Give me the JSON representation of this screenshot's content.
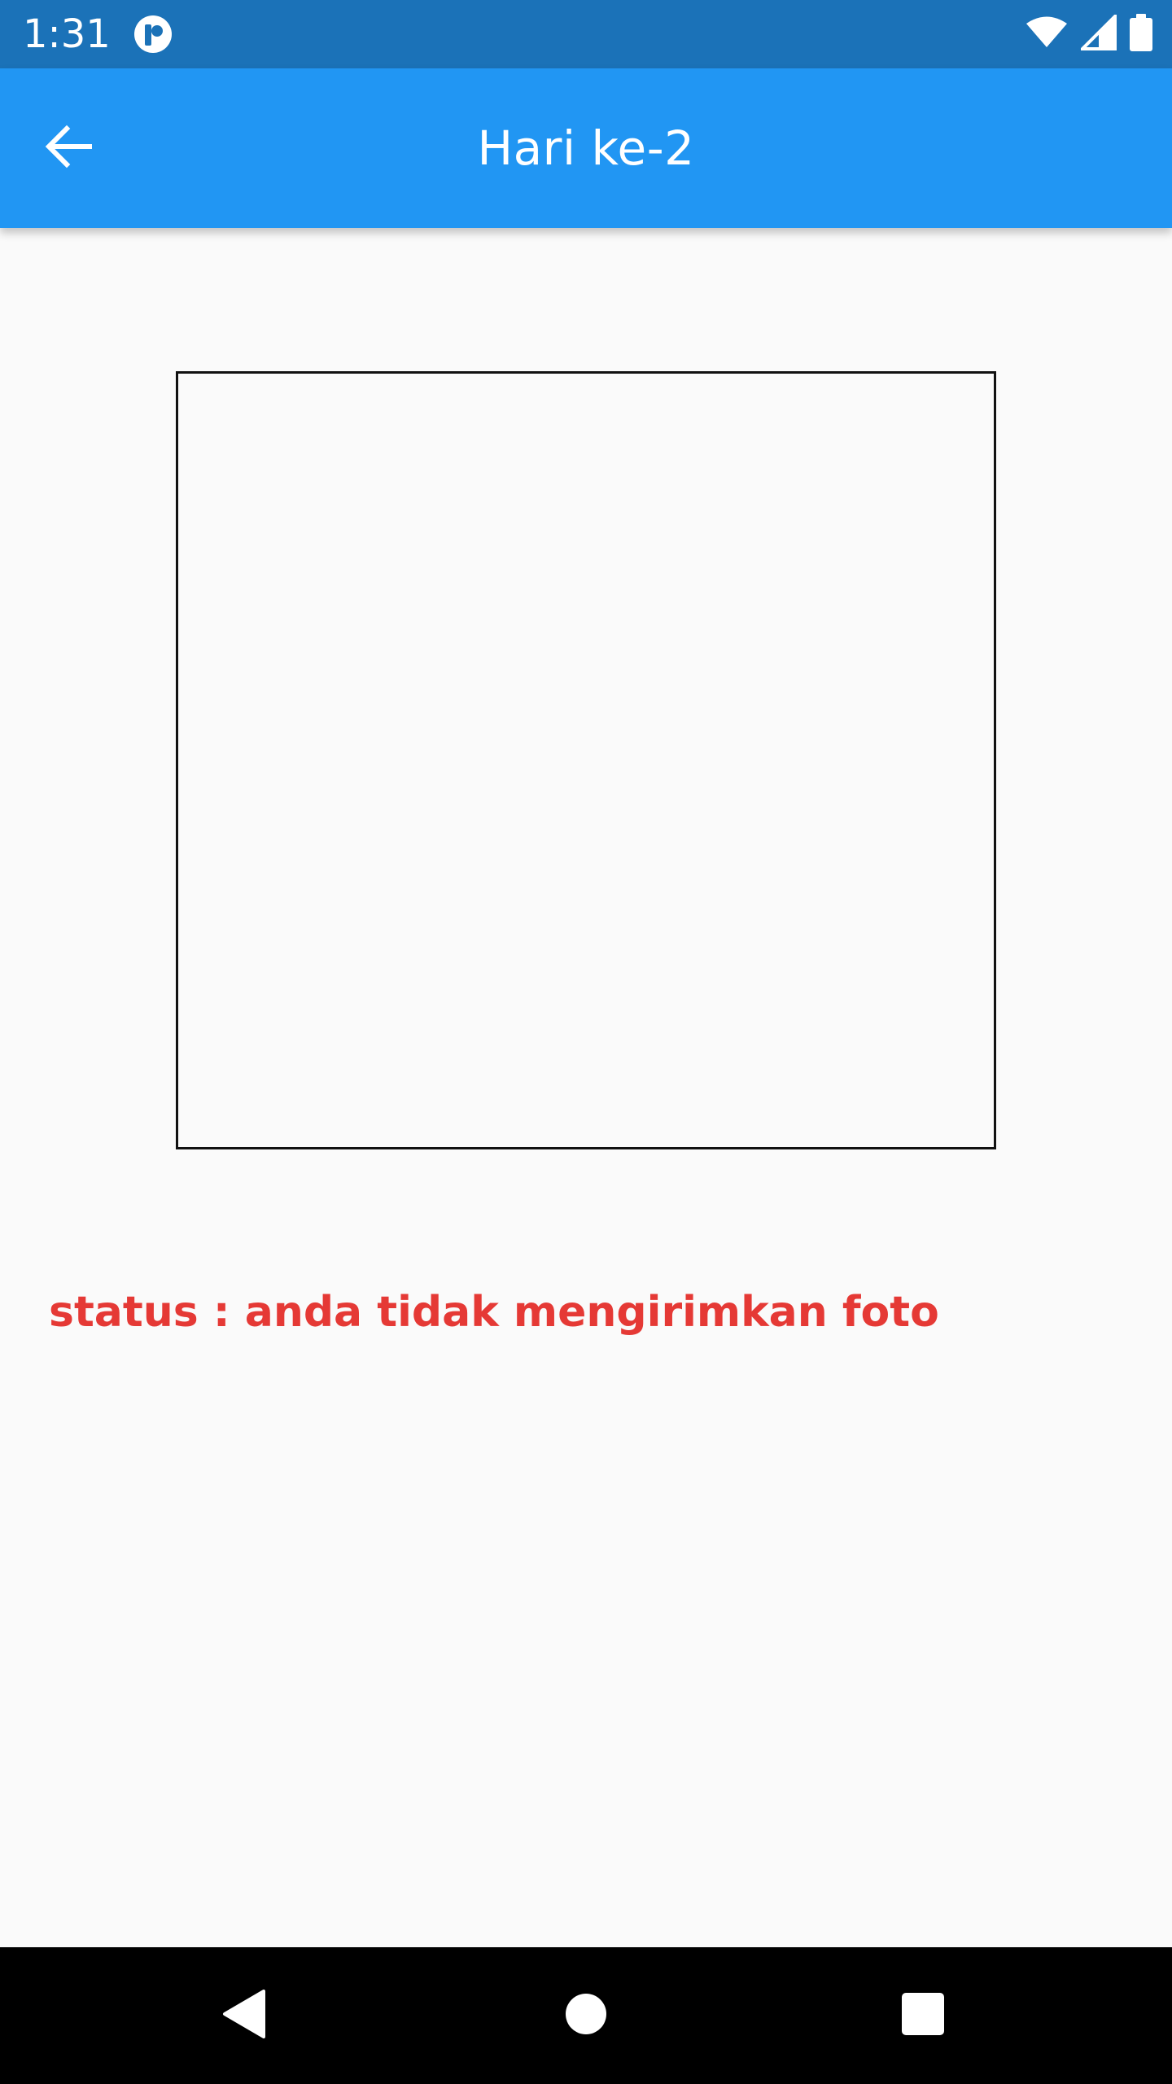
{
  "status_bar": {
    "time": "1:31",
    "app_icon": "notification-app-icon",
    "wifi_icon": "wifi-icon",
    "signal_icon": "cell-signal-icon",
    "battery_icon": "battery-icon",
    "background_color": "#1b72b8"
  },
  "app_bar": {
    "title": "Hari ke-2",
    "back_icon": "arrow-back-icon",
    "background_color": "#2196f3"
  },
  "main": {
    "photo_frame_icon": "empty-photo-frame",
    "status_text": "status : anda tidak mengirimkan foto",
    "status_color": "#e53935"
  },
  "nav_bar": {
    "back_icon": "triangle-back-icon",
    "home_icon": "circle-home-icon",
    "recents_icon": "square-recents-icon"
  }
}
